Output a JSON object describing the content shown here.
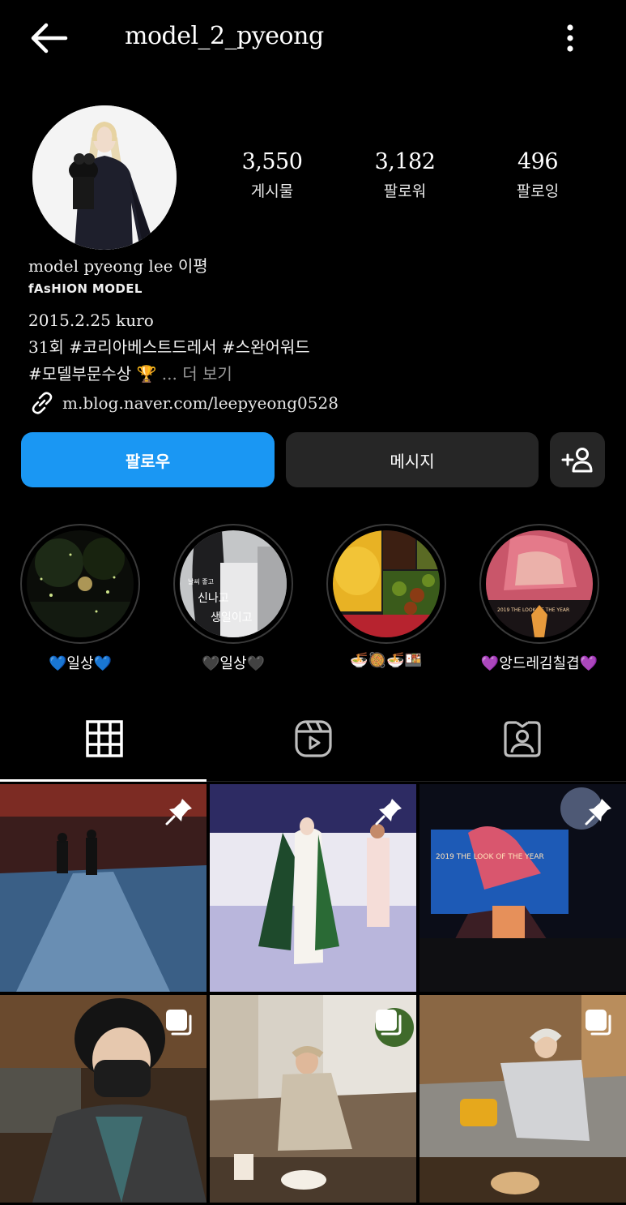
{
  "header": {
    "username": "model_2_pyeong",
    "back_icon": "arrow-left-icon",
    "menu_icon": "more-vertical-icon"
  },
  "profile": {
    "stats": [
      {
        "value": "3,550",
        "label": "게시물"
      },
      {
        "value": "3,182",
        "label": "팔로워"
      },
      {
        "value": "496",
        "label": "팔로잉"
      }
    ],
    "name": "model pyeong lee 이평",
    "category": "fAsHION MODEL",
    "bio_lines": [
      "2015.2.25 kuro",
      "31회 #코리아베스트드레서 #스완어워드"
    ],
    "bio_last_line": "#모델부문수상 🏆",
    "more_label": "... 더 보기",
    "link": "m.blog.naver.com/leepyeong0528"
  },
  "actions": {
    "follow_label": "팔로우",
    "message_label": "메시지",
    "add_user_icon": "add-user-icon"
  },
  "highlights": [
    {
      "label": "💙일상💙"
    },
    {
      "label": "🖤일상🖤",
      "overlay_small": "날씨 좋고",
      "overlay_line1": "신나고",
      "overlay_line2": "생일이고"
    },
    {
      "label": "🍜🥘🍜🍱"
    },
    {
      "label": "💜앙드레김칠겹💜",
      "overlay_small": "2019 THE LOOK OF THE YEAR"
    }
  ],
  "tabs": [
    {
      "name": "grid",
      "icon": "grid-icon",
      "active": true
    },
    {
      "name": "reels",
      "icon": "reels-icon",
      "active": false
    },
    {
      "name": "tagged",
      "icon": "tagged-user-icon",
      "active": false
    }
  ],
  "grid": [
    {
      "badge": "pin-icon"
    },
    {
      "badge": "pin-icon"
    },
    {
      "badge": "pin-icon",
      "overlay_text": "2019 THE LOOK OF THE YEAR"
    },
    {
      "badge": "carousel-icon"
    },
    {
      "badge": "carousel-icon"
    },
    {
      "badge": "carousel-icon"
    }
  ],
  "colors": {
    "background": "#000000",
    "follow_button": "#1a97f3",
    "secondary_button": "#262626",
    "muted_text": "#9a9a9a"
  }
}
